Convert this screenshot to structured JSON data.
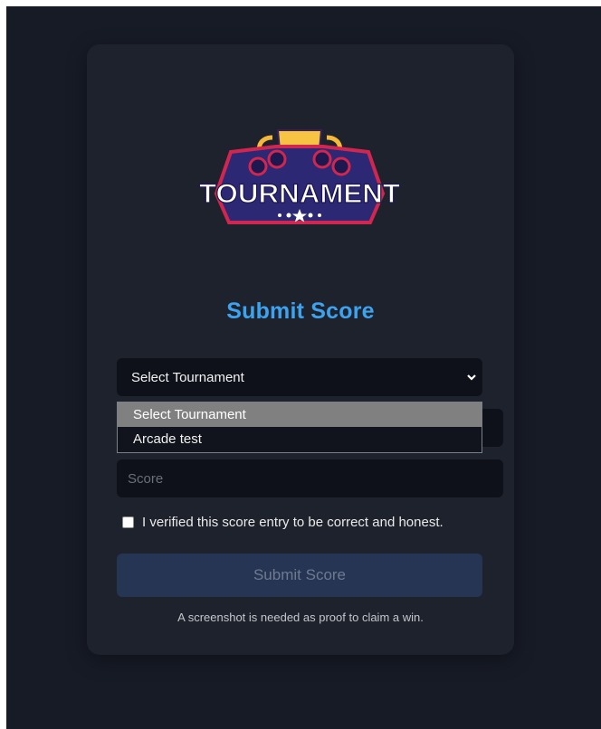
{
  "logo": {
    "text": "TOURNAMENT",
    "icon": "trophy-icon"
  },
  "form": {
    "title": "Submit Score",
    "tournament_select": {
      "selected": "Select Tournament",
      "options": [
        "Select Tournament",
        "Arcade test"
      ]
    },
    "score": {
      "placeholder": "Score",
      "value": ""
    },
    "verify_checkbox": {
      "label": "I verified this score entry to be correct and honest.",
      "checked": false
    },
    "submit_label": "Submit Score",
    "note": "A screenshot is needed as proof to claim a win."
  },
  "colors": {
    "page_bg": "#171b26",
    "card_bg": "#1e222d",
    "field_bg": "#0e111a",
    "accent": "#3ea3ee",
    "button_bg": "#263553",
    "option_highlight": "#808080"
  }
}
